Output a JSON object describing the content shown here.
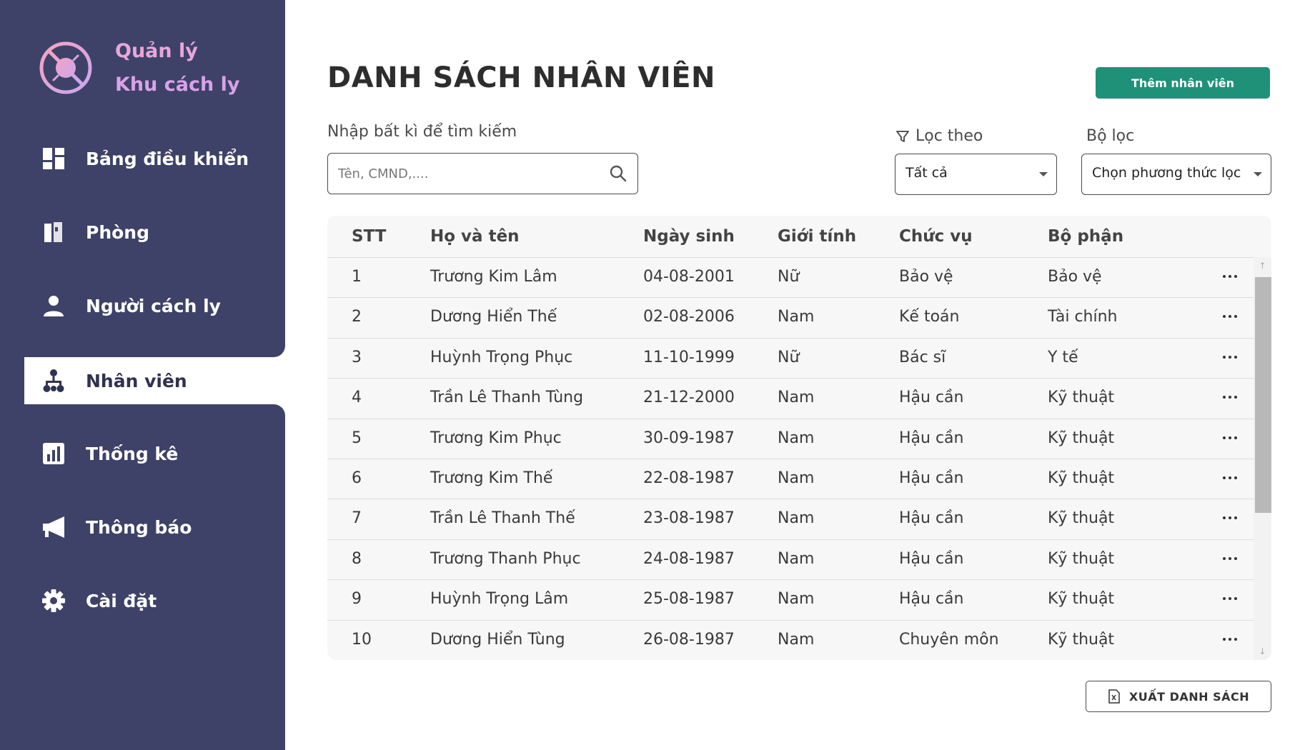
{
  "brand": {
    "line1": "Quản lý",
    "line2": "Khu cách ly"
  },
  "sidebar": {
    "items": [
      {
        "label": "Bảng điều khiển",
        "icon": "dashboard-icon"
      },
      {
        "label": "Phòng",
        "icon": "room-icon"
      },
      {
        "label": "Người cách ly",
        "icon": "person-icon"
      },
      {
        "label": "Nhân viên",
        "icon": "staff-icon",
        "active": true
      },
      {
        "label": "Thống kê",
        "icon": "chart-icon"
      },
      {
        "label": "Thông báo",
        "icon": "megaphone-icon"
      },
      {
        "label": "Cài đặt",
        "icon": "gear-icon"
      }
    ]
  },
  "header": {
    "title": "DANH SÁCH NHÂN VIÊN",
    "add_button": "Thêm nhân viên"
  },
  "search": {
    "label": "Nhập bất kì để tìm kiếm",
    "placeholder": "Tên, CMND,....",
    "value": ""
  },
  "filter": {
    "by_label": "Lọc theo",
    "by_value": "Tất cả",
    "filter_label": "Bộ lọc",
    "filter_value": "Chọn phương thức lọc"
  },
  "table": {
    "columns": [
      "STT",
      "Họ và tên",
      "Ngày sinh",
      "Giới tính",
      "Chức vụ",
      "Bộ phận"
    ],
    "rows": [
      [
        "1",
        "Trương Kim Lâm",
        "04-08-2001",
        "Nữ",
        "Bảo vệ",
        "Bảo vệ"
      ],
      [
        "2",
        "Dương Hiển Thế",
        "02-08-2006",
        "Nam",
        "Kế toán",
        "Tài chính"
      ],
      [
        "3",
        "Huỳnh Trọng Phục",
        "11-10-1999",
        "Nữ",
        "Bác sĩ",
        "Y tế"
      ],
      [
        "4",
        "Trần Lê Thanh Tùng",
        "21-12-2000",
        "Nam",
        "Hậu cần",
        "Kỹ thuật"
      ],
      [
        "5",
        "Trương Kim Phục",
        "30-09-1987",
        "Nam",
        "Hậu cần",
        "Kỹ thuật"
      ],
      [
        "6",
        "Trương Kim Thế",
        "22-08-1987",
        "Nam",
        "Hậu cần",
        "Kỹ thuật"
      ],
      [
        "7",
        "Trần Lê Thanh Thế",
        "23-08-1987",
        "Nam",
        "Hậu cần",
        "Kỹ thuật"
      ],
      [
        "8",
        "Trương Thanh Phục",
        "24-08-1987",
        "Nam",
        "Hậu cần",
        "Kỹ thuật"
      ],
      [
        "9",
        "Huỳnh Trọng Lâm",
        "25-08-1987",
        "Nam",
        "Hậu cần",
        "Kỹ thuật"
      ],
      [
        "10",
        "Dương Hiển Tùng",
        "26-08-1987",
        "Nam",
        "Chuyên môn",
        "Kỹ thuật"
      ]
    ]
  },
  "export": {
    "label": "XUẤT DANH SÁCH",
    "icon": "excel-file-icon"
  },
  "colors": {
    "sidebar": "#3e4268",
    "accent": "#1f9178",
    "brand": "#e9a6d9"
  }
}
